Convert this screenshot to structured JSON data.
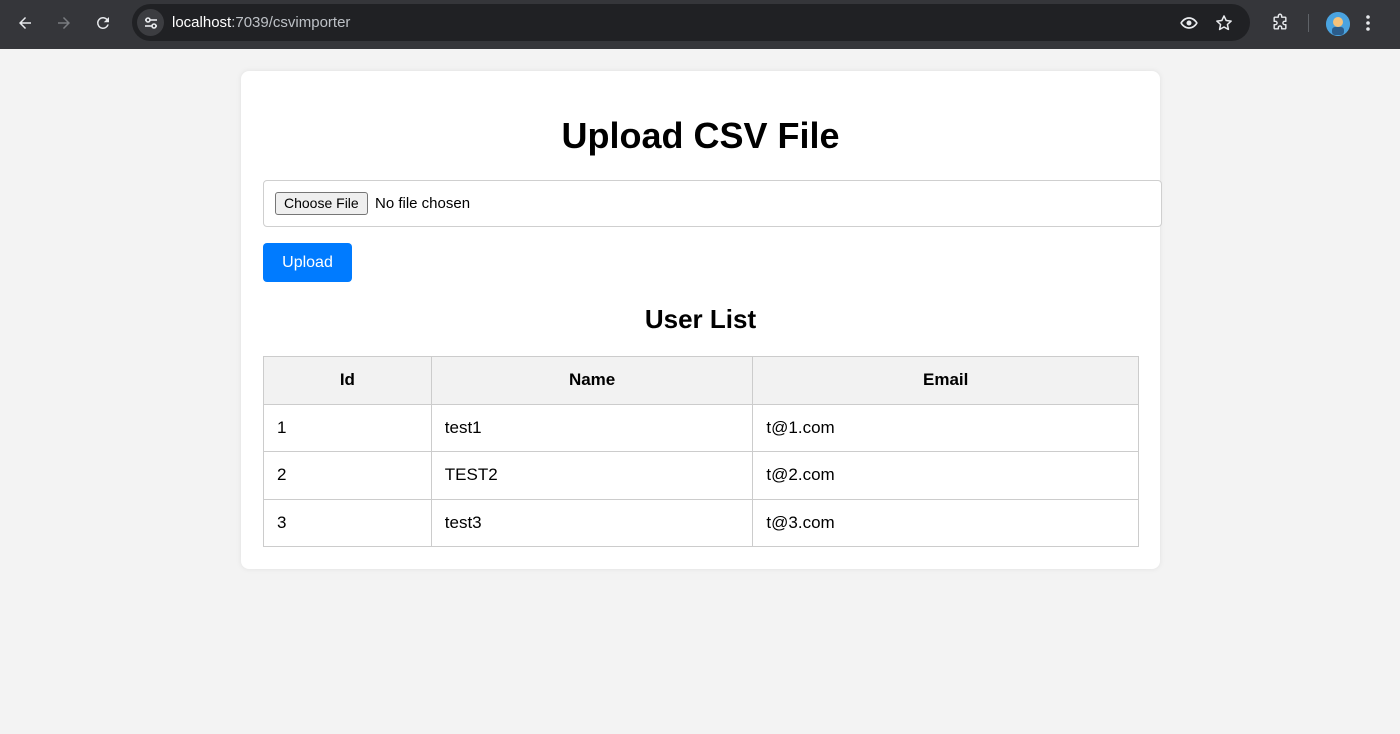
{
  "browser": {
    "url_host": "localhost",
    "url_rest": ":7039/csvimporter"
  },
  "page": {
    "title": "Upload CSV File",
    "file_button_label": "Choose File",
    "file_status": "No file chosen",
    "upload_label": "Upload",
    "subtitle": "User List"
  },
  "table": {
    "headers": [
      "Id",
      "Name",
      "Email"
    ],
    "rows": [
      [
        "1",
        "test1",
        "t@1.com"
      ],
      [
        "2",
        "TEST2",
        "t@2.com"
      ],
      [
        "3",
        "test3",
        "t@3.com"
      ]
    ]
  },
  "icons": {
    "back": "arrow-left-icon",
    "forward": "arrow-right-icon",
    "reload": "reload-icon",
    "site_info": "tune-icon",
    "eye": "eye-icon",
    "bookmark": "star-icon",
    "extensions": "puzzle-icon",
    "menu": "kebab-menu-icon"
  },
  "colors": {
    "accent": "#007bff",
    "page_bg": "#f3f3f3",
    "chrome_bg": "#35363a"
  }
}
